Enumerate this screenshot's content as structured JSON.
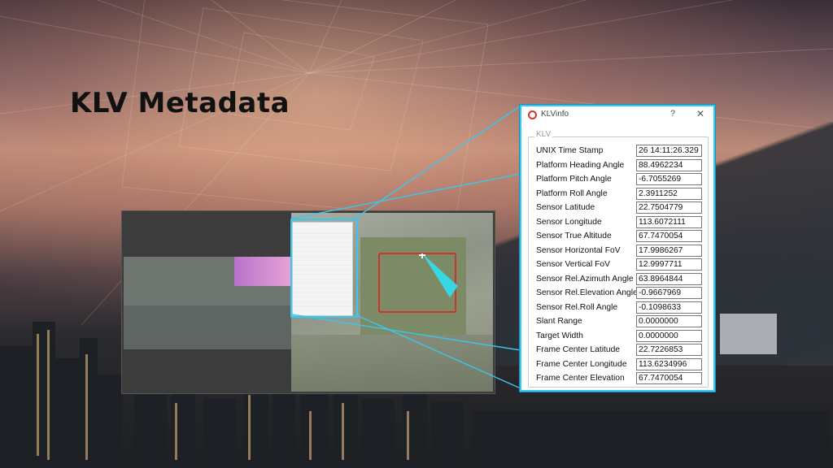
{
  "title": "KLV Metadata",
  "window": {
    "title": "KLVinfo",
    "help": "?",
    "close": "✕",
    "group_label": "KLV"
  },
  "fields": [
    {
      "label": "UNIX Time Stamp",
      "value": "26 14:11:26.329"
    },
    {
      "label": "Platform Heading Angle",
      "value": "88.4962234"
    },
    {
      "label": "Platform Pitch Angle",
      "value": "-6.7055269"
    },
    {
      "label": "Platform Roll Angle",
      "value": "2.3911252"
    },
    {
      "label": "Sensor Latitude",
      "value": "22.7504779"
    },
    {
      "label": "Sensor Longitude",
      "value": "113.6072111"
    },
    {
      "label": "Sensor True Altitude",
      "value": "67.7470054"
    },
    {
      "label": "Sensor Horizontal FoV",
      "value": "17.9986267"
    },
    {
      "label": "Sensor Vertical FoV",
      "value": "12.9997711"
    },
    {
      "label": "Sensor Rel.Azimuth Angle",
      "value": "63.8964844"
    },
    {
      "label": "Sensor Rel.Elevation Angle",
      "value": "-0.9667969"
    },
    {
      "label": "Sensor Rel.Roll Angle",
      "value": "-0.1098633"
    },
    {
      "label": "Slant Range",
      "value": "0.0000000"
    },
    {
      "label": "Target Width",
      "value": "0.0000000"
    },
    {
      "label": "Frame Center Latitude",
      "value": "22.7226853"
    },
    {
      "label": "Frame Center Longitude",
      "value": "113.6234996"
    },
    {
      "label": "Frame Center Elevation",
      "value": "67.7470054"
    }
  ],
  "colors": {
    "accent": "#37c8f0",
    "logo": "#d8342c",
    "target_box": "#d0312d",
    "cone": "#2fe0f0"
  }
}
